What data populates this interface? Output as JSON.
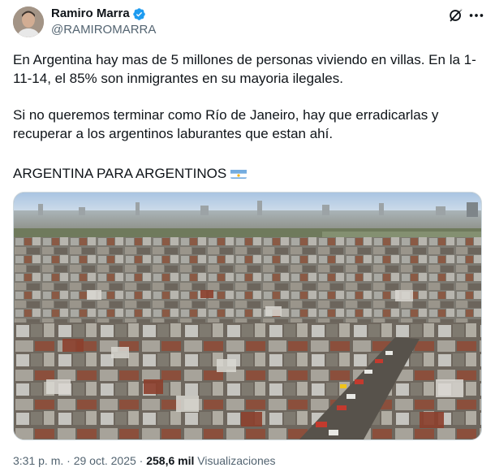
{
  "author": {
    "display_name": "Ramiro Marra",
    "handle": "@RAMIROMARRA",
    "verified": true,
    "verified_color": "#1d9bf0"
  },
  "header_actions": {
    "grok_icon": "grok-icon",
    "more_icon": "more-icon"
  },
  "tweet": {
    "paragraph_1": "En Argentina hay mas de 5 millones de personas viviendo en villas. En la 1-11-14, el 85% son inmigrantes en su mayoria ilegales.",
    "paragraph_2": "Si no queremos terminar como Río de Janeiro, hay que erradicarlas y recuperar a los argentinos laburantes que estan ahí.",
    "paragraph_3": "ARGENTINA PARA ARGENTINOS",
    "flag_icon": "argentina-flag-icon"
  },
  "media": {
    "kind": "aerial photo of dense informal settlement"
  },
  "meta": {
    "time": "3:31 p. m.",
    "separator": "·",
    "date": "29 oct. 2025",
    "views_count": "258,6 mil",
    "views_label": "Visualizaciones"
  },
  "colors": {
    "text_primary": "#0f1419",
    "text_secondary": "#536471",
    "border": "#cfd9de",
    "flag_blue": "#74acdf",
    "flag_sun": "#f6b40e"
  }
}
